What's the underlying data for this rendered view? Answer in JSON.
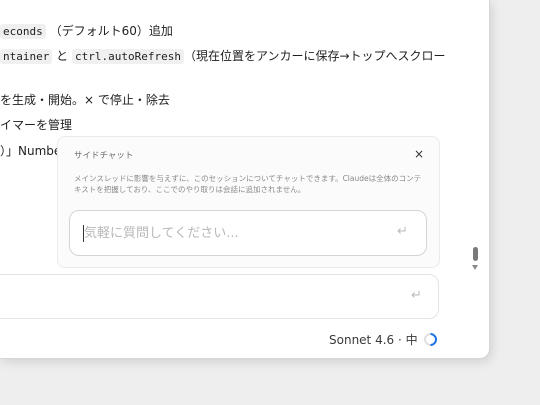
{
  "document": {
    "line1": {
      "code": "econds",
      "text": "（デフォルト60）追加"
    },
    "line2": {
      "code1": "ntainer",
      "mid": " と ",
      "code2": "ctrl.autoRefresh",
      "text": "（現在位置をアンカーに保存→トップへスクロー"
    },
    "line3": "を生成・開始。× で停止・除去",
    "line4": "イマーを管理",
    "line5": "）」Numbe"
  },
  "side_chat": {
    "title": "サイドチャット",
    "close_icon": "×",
    "description": "メインスレッドに影響を与えずに、このセッションについてチャットできます。Claudeは全体のコンテキストを把握しており、ここでのやり取りは会話に追加されません。",
    "placeholder": "気軽に質問してください...",
    "send_icon": "↵"
  },
  "composer": {
    "send_icon": "↵"
  },
  "status": {
    "model": "Sonnet 4.6 · 中"
  },
  "colors": {
    "accent": "#1a73e8",
    "placeholder": "#b8b8b8"
  }
}
